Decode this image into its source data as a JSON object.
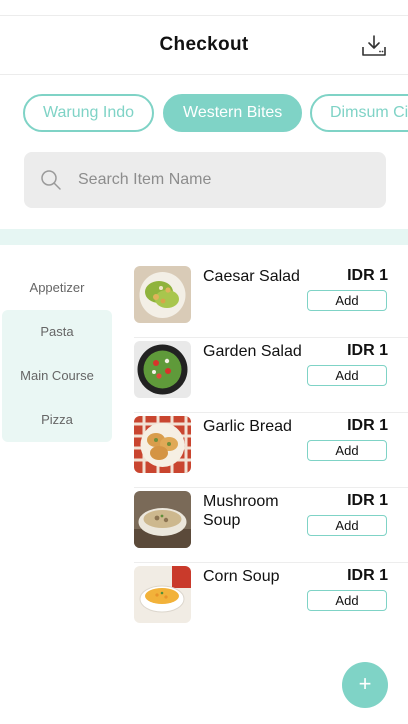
{
  "header": {
    "title": "Checkout",
    "download_icon": "download-tray-icon"
  },
  "tabs": [
    {
      "label": "Warung Indo",
      "active": false
    },
    {
      "label": "Western Bites",
      "active": true
    },
    {
      "label": "Dimsum Ci",
      "active": false
    }
  ],
  "search": {
    "placeholder": "Search Item Name",
    "value": ""
  },
  "categories": [
    "Appetizer",
    "Pasta",
    "Main Course",
    "Pizza"
  ],
  "items": [
    {
      "name": "Caesar Salad",
      "price": "IDR 1",
      "add_label": "Add"
    },
    {
      "name": "Garden Salad",
      "price": "IDR 1",
      "add_label": "Add"
    },
    {
      "name": "Garlic Bread",
      "price": "IDR 1",
      "add_label": "Add"
    },
    {
      "name": "Mushroom Soup",
      "price": "IDR 1",
      "add_label": "Add"
    },
    {
      "name": "Corn Soup",
      "price": "IDR 1",
      "add_label": "Add"
    }
  ],
  "fab": {
    "label": "+"
  },
  "colors": {
    "accent": "#7fd3c6",
    "band": "#e6f6f3",
    "search_bg": "#ececec"
  }
}
